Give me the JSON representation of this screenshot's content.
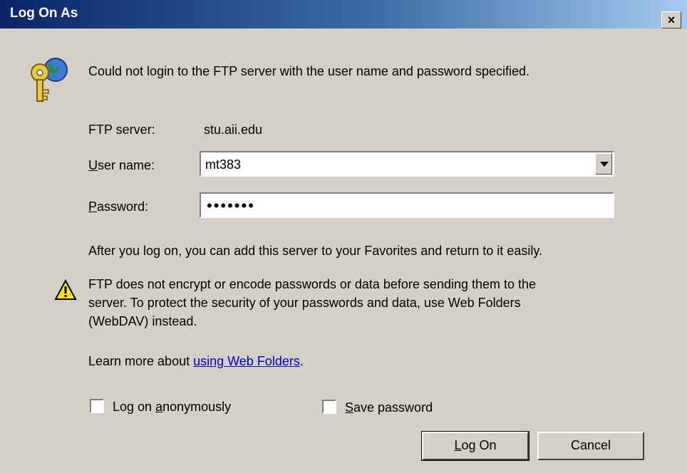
{
  "window": {
    "title": "Log On As",
    "close_glyph": "×"
  },
  "message": "Could not login to the FTP server with the user name and password specified.",
  "ftp_server": {
    "label": "FTP server:",
    "value": "stu.aii.edu"
  },
  "user_name": {
    "label_u": "U",
    "label_rest": "ser name:",
    "value": "mt383"
  },
  "password": {
    "label_u": "P",
    "label_rest": "assword:",
    "masked_value": "•••••••"
  },
  "favorites_note": "After you log on, you can add this server to your Favorites and return to it easily.",
  "warning": {
    "line1": "FTP does not encrypt or encode passwords or data before sending them to the",
    "line2": "server.  To protect the security of your passwords and data, use Web Folders",
    "line3": "(WebDAV) instead."
  },
  "learn_more": {
    "prefix": "Learn more about ",
    "link": "using Web Folders",
    "suffix": "."
  },
  "anonymous": {
    "pre": "Log on ",
    "u": "a",
    "post": "nonymously",
    "checked": false
  },
  "save_password": {
    "u": "S",
    "post": "ave password",
    "checked": false
  },
  "buttons": {
    "logon_u": "L",
    "logon_rest": "og On",
    "cancel": "Cancel"
  },
  "icons": [
    "key-globe-icon",
    "warning-icon",
    "dropdown-arrow-icon",
    "close-icon"
  ]
}
